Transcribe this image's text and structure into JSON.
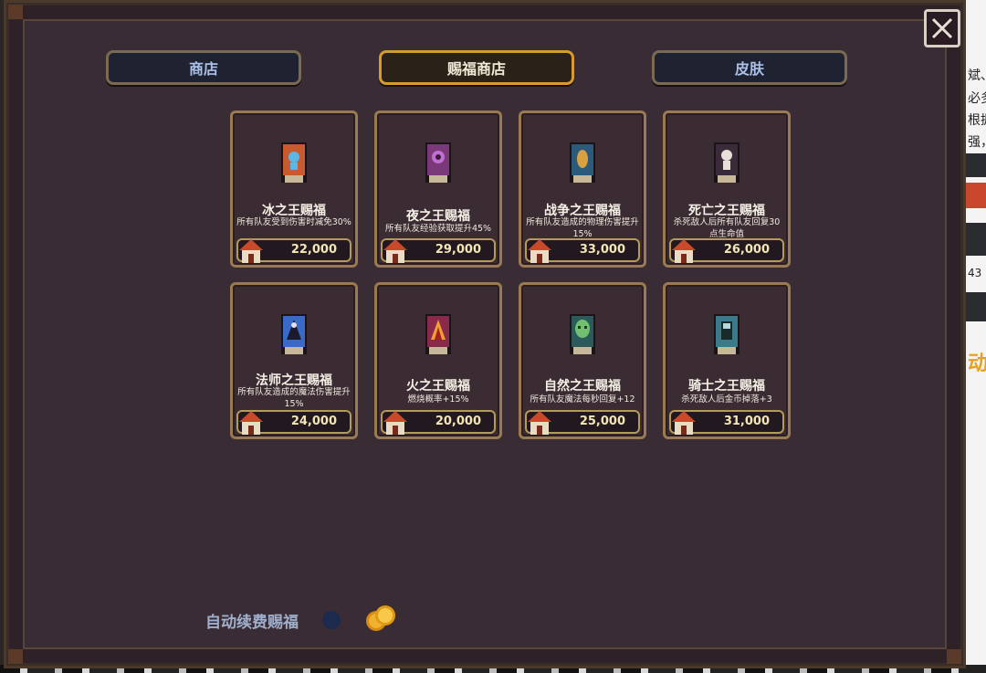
{
  "tabs": [
    {
      "label": "商店"
    },
    {
      "label": "赐福商店"
    },
    {
      "label": "皮肤"
    }
  ],
  "cards": [
    {
      "name": "冰之王赐福",
      "desc": "所有队友受到伤害时减免30%",
      "price": "22,000",
      "banner_color": "#c85a30",
      "emblem_color": "#5ab8e8"
    },
    {
      "name": "夜之王赐福",
      "desc": "所有队友经验获取提升45%",
      "price": "29,000",
      "banner_color": "#7a3a7a",
      "emblem_color": "#c070d0"
    },
    {
      "name": "战争之王赐福",
      "desc": "所有队友造成的物理伤害提升15%",
      "price": "33,000",
      "banner_color": "#2c5a7a",
      "emblem_color": "#d8a040"
    },
    {
      "name": "死亡之王赐福",
      "desc": "杀死敌人后所有队友回复30点生命值",
      "price": "26,000",
      "banner_color": "#3a2a3a",
      "emblem_color": "#e8e0d8"
    },
    {
      "name": "法师之王赐福",
      "desc": "所有队友造成的魔法伤害提升15%",
      "price": "24,000",
      "banner_color": "#3a6ac8",
      "emblem_color": "#e0e0f0"
    },
    {
      "name": "火之王赐福",
      "desc": "燃烧概率+15%",
      "price": "20,000",
      "banner_color": "#8a2a4a",
      "emblem_color": "#f0a030"
    },
    {
      "name": "自然之王赐福",
      "desc": "所有队友魔法每秒回复+12",
      "price": "25,000",
      "banner_color": "#2a5a5a",
      "emblem_color": "#70c070"
    },
    {
      "name": "骑士之王赐福",
      "desc": "杀死敌人后金币掉落+3",
      "price": "31,000",
      "banner_color": "#3a7a8a",
      "emblem_color": "#b8d8e0"
    }
  ],
  "auto_renew": {
    "label": "自动续费赐福"
  },
  "background_page": {
    "lines": [
      "斌、",
      "必多",
      "根据",
      "强，",
      "43",
      "动"
    ]
  },
  "colors": {
    "panel_bg": "#3a2c34",
    "tab_active_border": "#d89a2a",
    "card_border": "#9a7a52",
    "price_text": "#f3e6b4",
    "tab_text": "#a9c0e8"
  },
  "icons": {
    "close": "close-icon",
    "currency": "gold-coins-icon",
    "shop": "house-icon"
  }
}
